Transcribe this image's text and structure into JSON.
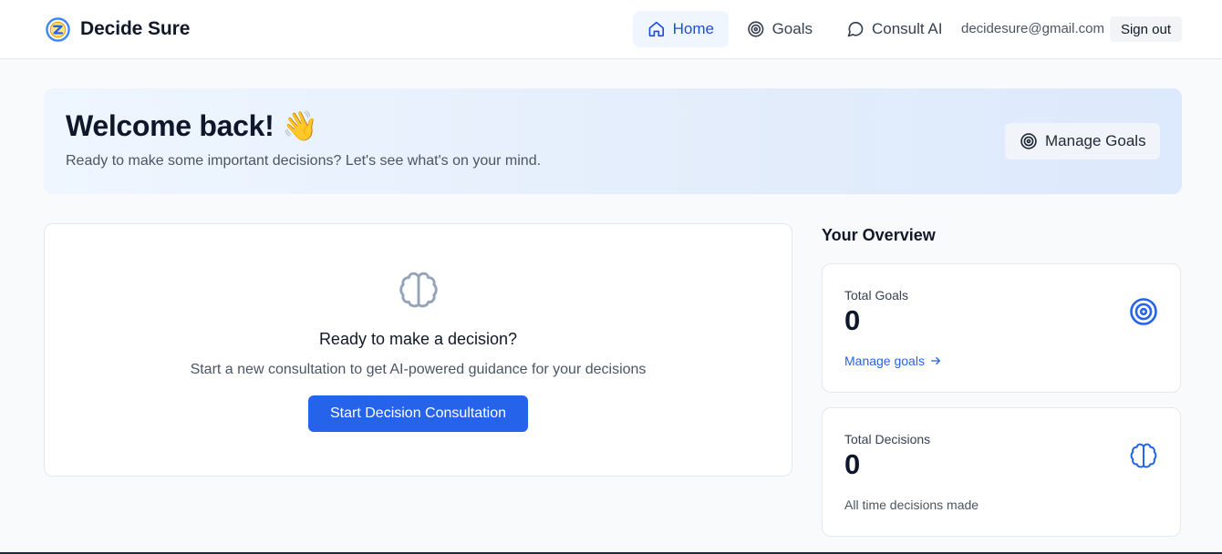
{
  "header": {
    "brand_name": "Decide Sure",
    "nav": [
      {
        "label": "Home",
        "icon": "home-icon",
        "active": true
      },
      {
        "label": "Goals",
        "icon": "target-icon",
        "active": false
      },
      {
        "label": "Consult AI",
        "icon": "message-circle-icon",
        "active": false
      }
    ],
    "user_email": "decidesure@gmail.com",
    "sign_out_label": "Sign out"
  },
  "welcome": {
    "title": "Welcome back! 👋",
    "subtitle": "Ready to make some important decisions? Let's see what's on your mind.",
    "manage_goals_label": "Manage Goals"
  },
  "consult": {
    "icon": "brain-icon",
    "title": "Ready to make a decision?",
    "subtitle": "Start a new consultation to get AI-powered guidance for your decisions",
    "button_label": "Start Decision Consultation"
  },
  "overview": {
    "title": "Your Overview",
    "goals": {
      "label": "Total Goals",
      "value": "0",
      "link_label": "Manage goals",
      "icon": "target-icon"
    },
    "decisions": {
      "label": "Total Decisions",
      "value": "0",
      "note": "All time decisions made",
      "icon": "brain-icon"
    }
  },
  "colors": {
    "accent": "#2563eb",
    "active_nav_bg": "#eff6ff",
    "page_bg": "#f8fafc",
    "muted_icon": "#94a3b8"
  }
}
